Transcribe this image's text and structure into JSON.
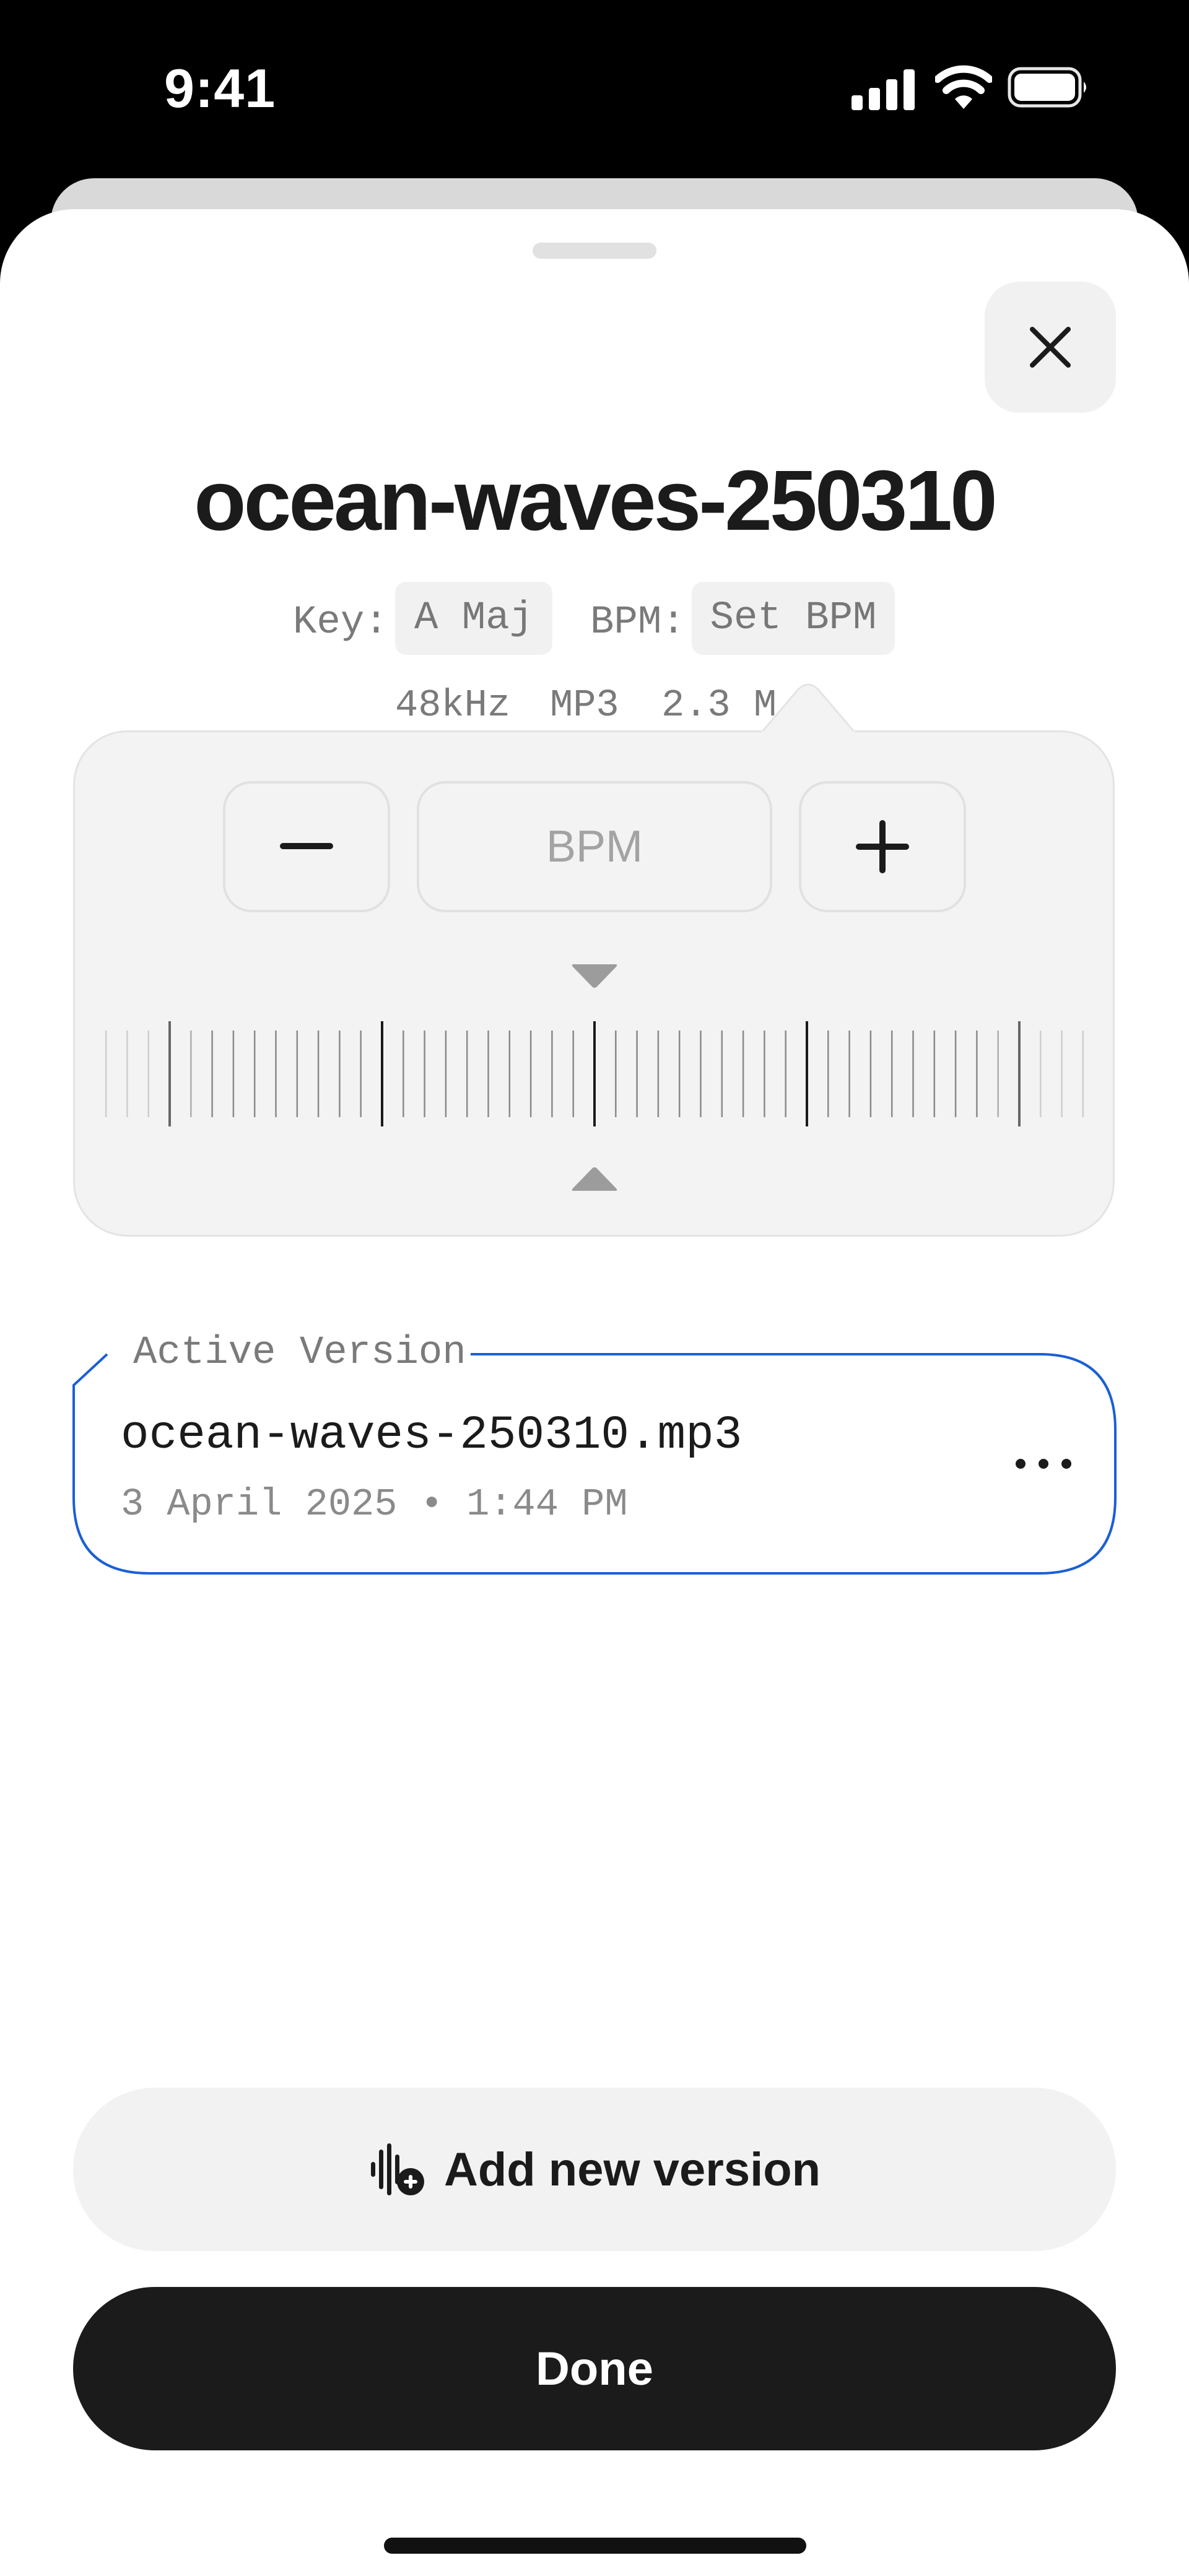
{
  "status_bar": {
    "time": "9:41"
  },
  "track": {
    "title": "ocean-waves-250310",
    "key_label": "Key:",
    "key_value": "A Maj",
    "bpm_label": "BPM:",
    "bpm_value": "Set BPM",
    "sample_rate": "48kHz",
    "format": "MP3",
    "size": "2.3 M"
  },
  "bpm_popover": {
    "decrement_icon": "minus-icon",
    "increment_icon": "plus-icon",
    "input_placeholder": "BPM"
  },
  "active_version": {
    "legend": "Active Version",
    "file_name": "ocean-waves-250310.mp3",
    "date": "3 April 2025 • 1:44 PM",
    "accent_color": "#1a5fd6"
  },
  "actions": {
    "add_version_label": "Add new version",
    "add_version_icon": "waveform-plus-icon",
    "done_label": "Done"
  },
  "colors": {
    "primary_button": "#1b1b1b",
    "secondary_button": "#f2f2f2"
  }
}
